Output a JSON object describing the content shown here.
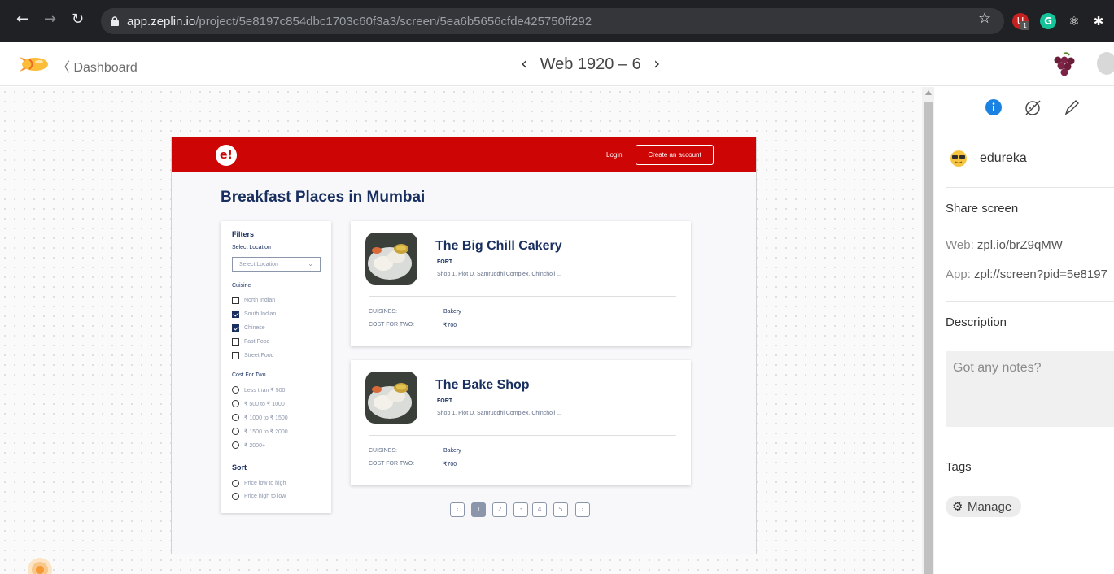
{
  "browser": {
    "url_host": "app.zeplin.io",
    "url_path": "/project/5e8197c854dbc1703c60f3a3/screen/5ea6b5656cfde425750ff292",
    "extension_badge": "1"
  },
  "header": {
    "back_label": "Dashboard",
    "screen_name": "Web 1920 – 6"
  },
  "design": {
    "logo_text": "e!",
    "login_label": "Login",
    "create_account_label": "Create an account",
    "page_title": "Breakfast Places in Mumbai",
    "filters": {
      "title": "Filters",
      "location_label": "Select Location",
      "location_placeholder": "Select Location",
      "cuisine_title": "Cuisine",
      "cuisines": [
        {
          "label": "North Indian",
          "checked": false
        },
        {
          "label": "South Indian",
          "checked": true
        },
        {
          "label": "Chinese",
          "checked": true
        },
        {
          "label": "Fast Food",
          "checked": false
        },
        {
          "label": "Street Food",
          "checked": false
        }
      ],
      "cost_title": "Cost For Two",
      "costs": [
        "Less than ₹ 500",
        "₹ 500 to ₹ 1000",
        "₹ 1000 to ₹ 1500",
        "₹ 1500 to ₹ 2000",
        "₹ 2000+"
      ],
      "sort_title": "Sort",
      "sorts": [
        "Price low to high",
        "Price high to low"
      ]
    },
    "restaurants": [
      {
        "name": "The Big Chill Cakery",
        "area": "FORT",
        "address": "Shop 1, Plot D, Samruddhi Complex, Chincholi ...",
        "cuisines_label": "CUISINES:",
        "cuisines_value": "Bakery",
        "cost_label": "COST FOR TWO:",
        "cost_value": "₹700"
      },
      {
        "name": "The Bake Shop",
        "area": "FORT",
        "address": "Shop 1, Plot D, Samruddhi Complex, Chincholi ...",
        "cuisines_label": "CUISINES:",
        "cuisines_value": "Bakery",
        "cost_label": "COST FOR TWO:",
        "cost_value": "₹700"
      }
    ],
    "pagination": [
      "‹",
      "1",
      "2",
      "3",
      "4",
      "5",
      "›"
    ],
    "current_page": "1"
  },
  "panel": {
    "user_name": "edureka",
    "share_title": "Share screen",
    "web_label": "Web:",
    "web_link": "zpl.io/brZ9qMW",
    "app_label": "App:",
    "app_link": "zpl://screen?pid=5e8197",
    "description_title": "Description",
    "notes_placeholder": "Got any notes?",
    "tags_title": "Tags",
    "manage_label": "Manage"
  },
  "colors": {
    "zomato_red": "#ce0505",
    "navy": "#192f60",
    "info_blue": "#1a82e2",
    "zeplin_orange": "#f69833"
  }
}
